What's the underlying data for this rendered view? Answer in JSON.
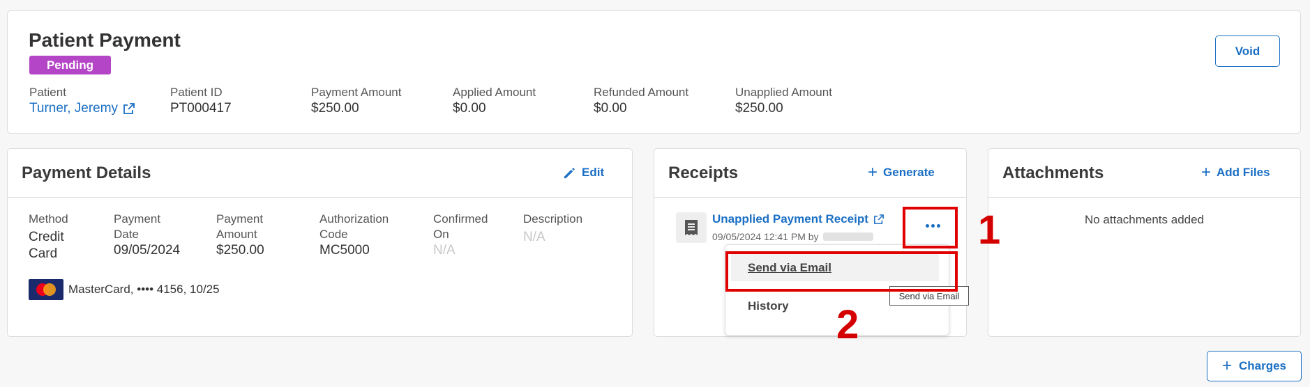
{
  "header": {
    "title": "Patient Payment",
    "status": "Pending",
    "void_label": "Void",
    "fields": [
      {
        "label": "Patient",
        "value": "Turner, Jeremy"
      },
      {
        "label": "Patient ID",
        "value": "PT000417"
      },
      {
        "label": "Payment Amount",
        "value": "$250.00"
      },
      {
        "label": "Applied Amount",
        "value": "$0.00"
      },
      {
        "label": "Refunded Amount",
        "value": "$0.00"
      },
      {
        "label": "Unapplied Amount",
        "value": "$250.00"
      }
    ]
  },
  "payment_details": {
    "title": "Payment Details",
    "edit_label": "Edit",
    "method_label": "Method",
    "method_value_1": "Credit",
    "method_value_2": "Card",
    "date_label_1": "Payment",
    "date_label_2": "Date",
    "date_value": "09/05/2024",
    "amount_label_1": "Payment",
    "amount_label_2": "Amount",
    "amount_value": "$250.00",
    "auth_label_1": "Authorization",
    "auth_label_2": "Code",
    "auth_value": "MC5000",
    "confirmed_label_1": "Confirmed",
    "confirmed_label_2": "On",
    "confirmed_value": "N/A",
    "description_label": "Description",
    "description_value": "N/A",
    "card_text": "MasterCard, •••• 4156, 10/25"
  },
  "receipts": {
    "title": "Receipts",
    "generate_label": "Generate",
    "receipt_name": "Unapplied Payment Receipt",
    "receipt_meta": "09/05/2024 12:41 PM by",
    "menu": [
      "Send via Email",
      "History"
    ],
    "tooltip": "Send via Email"
  },
  "attachments": {
    "title": "Attachments",
    "add_label": "Add Files",
    "empty_text": "No attachments added"
  },
  "charges_label": "Charges",
  "annotations": {
    "one": "1",
    "two": "2"
  },
  "colors": {
    "accent": "#1a6fc4",
    "status": "#b545c7",
    "annotation": "#e00000"
  }
}
